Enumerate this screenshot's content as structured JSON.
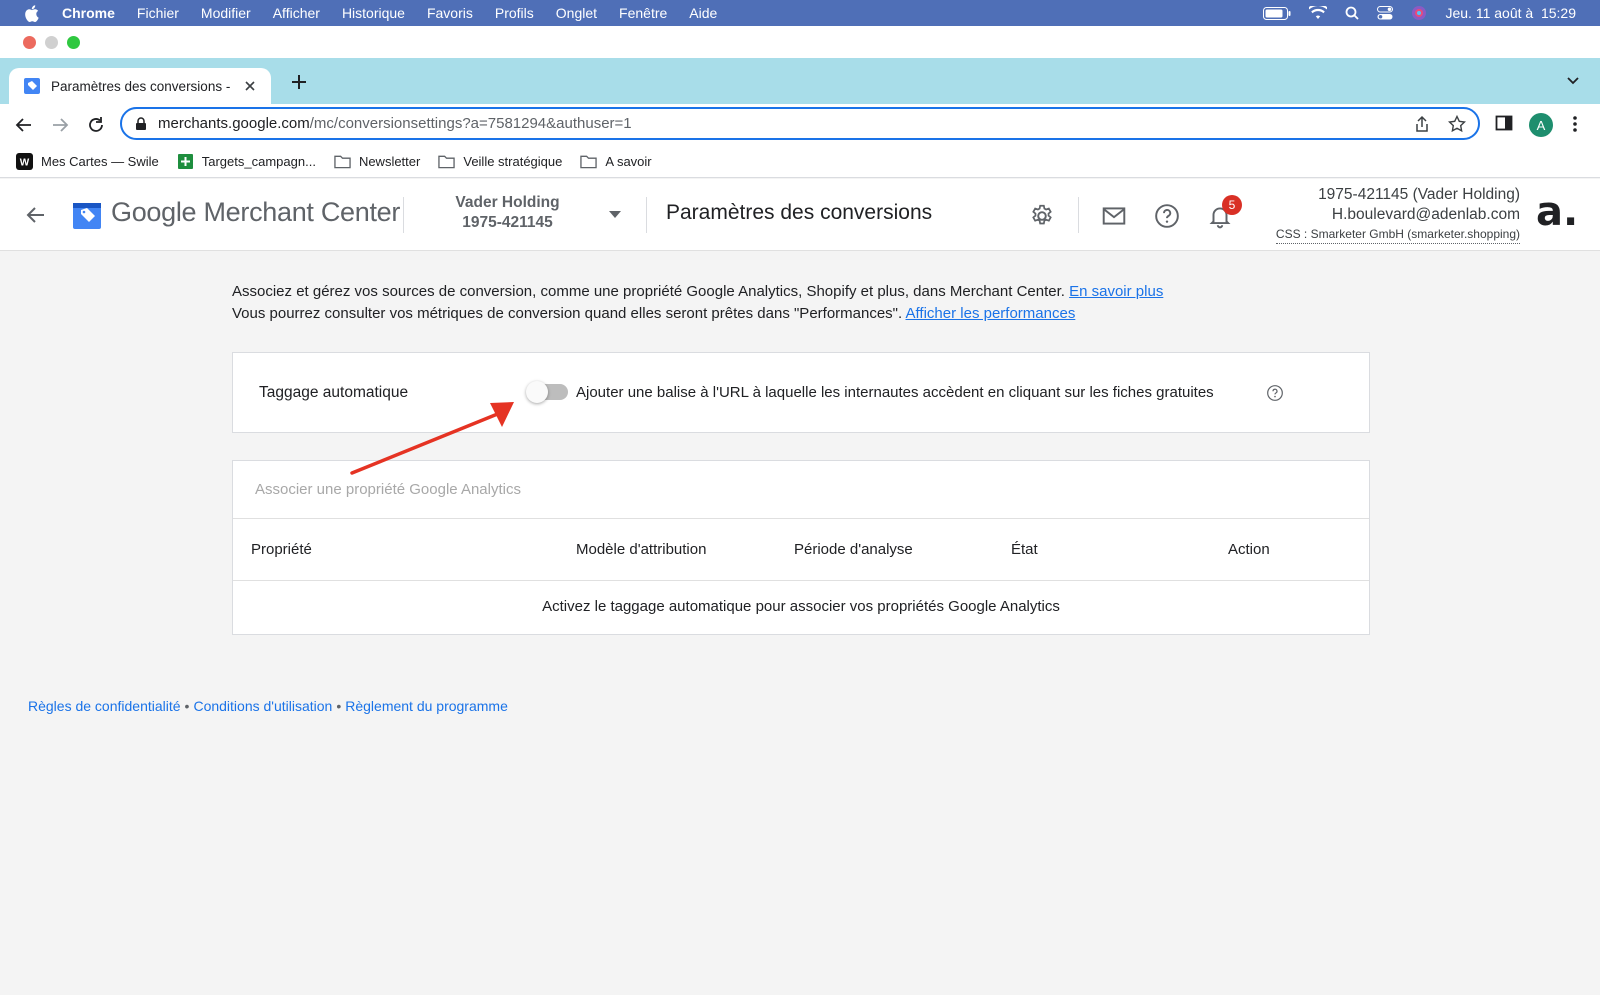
{
  "menubar": {
    "app": "Chrome",
    "items": [
      "Fichier",
      "Modifier",
      "Afficher",
      "Historique",
      "Favoris",
      "Profils",
      "Onglet",
      "Fenêtre",
      "Aide"
    ],
    "datetime": "Jeu. 11 août à  15:29"
  },
  "browser": {
    "tab_title": "Paramètres des conversions - ",
    "url_host": "merchants.google.com",
    "url_path": "/mc/conversionsettings?a=7581294&authuser=1",
    "profile_initial": "A",
    "bookmarks": [
      {
        "label": "Mes Cartes — Swile",
        "icon": "swile-icon"
      },
      {
        "label": "Targets_campagn...",
        "icon": "sheets-icon"
      },
      {
        "label": "Newsletter",
        "icon": "folder-icon"
      },
      {
        "label": "Veille stratégique",
        "icon": "folder-icon"
      },
      {
        "label": "A savoir",
        "icon": "folder-icon"
      }
    ]
  },
  "header": {
    "brand": "Google Merchant Center",
    "account_name": "Vader Holding",
    "account_id": "1975-421145",
    "page_title": "Paramètres des conversions",
    "notification_count": "5",
    "account_line1": "1975-421145 (Vader Holding)",
    "account_line2": "H.boulevard@adenlab.com",
    "account_line3": "CSS : Smarketer GmbH (smarketer.shopping)",
    "logo_text": "a."
  },
  "intro": {
    "line1": "Associez et gérez vos sources de conversion, comme une propriété Google Analytics, Shopify et plus, dans Merchant Center. ",
    "link1": "En savoir plus",
    "line2": "Vous pourrez consulter vos métriques de conversion quand elles seront prêtes dans \"Performances\". ",
    "link2": "Afficher les performances"
  },
  "auto_tagging": {
    "label": "Taggage automatique",
    "enabled": false,
    "description": "Ajouter une balise à l'URL à laquelle les internautes accèdent en cliquant sur les fiches gratuites"
  },
  "analytics": {
    "header": "Associer une propriété Google Analytics",
    "columns": [
      "Propriété",
      "Modèle d'attribution",
      "Période d'analyse",
      "État",
      "Action"
    ],
    "empty_message": "Activez le taggage automatique pour associer vos propriétés Google Analytics"
  },
  "footer": {
    "links": [
      "Règles de confidentialité",
      "Conditions d'utilisation",
      "Règlement du programme"
    ],
    "separator": "•"
  },
  "colors": {
    "menubar_bg": "#4f6fb7",
    "tabstrip_bg": "#a8dde9",
    "link": "#1a73e8",
    "badge": "#d93025",
    "annotation_arrow": "#e53323"
  }
}
